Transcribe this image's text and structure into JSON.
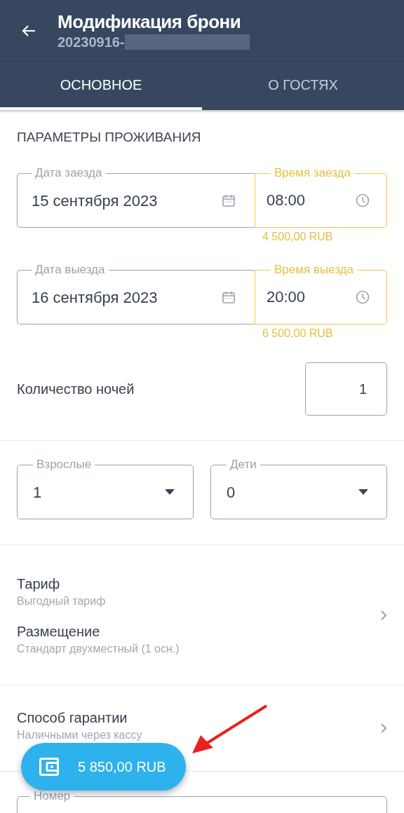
{
  "header": {
    "title": "Модификация брони",
    "booking_number": "20230916-",
    "redacted": true
  },
  "tabs": [
    {
      "label": "ОСНОВНОЕ",
      "selected": true
    },
    {
      "label": "О ГОСТЯХ",
      "selected": false
    }
  ],
  "stay": {
    "title": "ПАРАМЕТРЫ ПРОЖИВАНИЯ",
    "rows": [
      {
        "date_label": "Дата заезда",
        "date": "15 сентября 2023",
        "time_label": "Время заезда",
        "time": "08:00",
        "highlighted": true,
        "price": "4 500,00 RUB"
      },
      {
        "date_label": "Дата выезда",
        "date": "16 сентября 2023",
        "time_label": "Время выезда",
        "time": "20:00",
        "highlighted": true,
        "price": "6 500,00 RUB"
      }
    ],
    "nights_label": "Количество ночей",
    "nights": "1"
  },
  "guests": [
    {
      "label": "Взрослые",
      "value": "1"
    },
    {
      "label": "Дети",
      "value": "0"
    }
  ],
  "rate_items": [
    {
      "title": "Тариф",
      "subtitle": "Выгодный тариф"
    },
    {
      "title": "Размещение",
      "subtitle": "Стандарт двухместный (1 осн.)"
    }
  ],
  "guarantee": {
    "title": "Способ гарантии",
    "subtitle": "Наличными через кассу"
  },
  "room_field": {
    "label": "Номер"
  },
  "total_button": {
    "label": "5 850,00 RUB"
  },
  "annotation_arrow": true
}
